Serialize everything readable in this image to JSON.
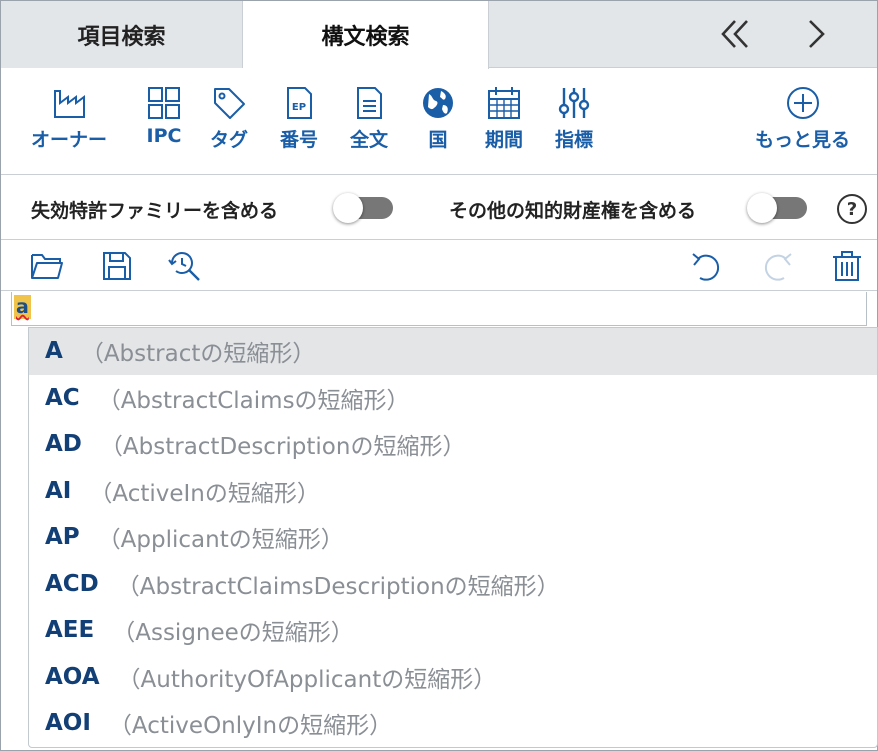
{
  "tabs": {
    "item_search": "項目検索",
    "syntax_search": "構文検索"
  },
  "filters": [
    {
      "label": "オーナー",
      "icon": "factory-icon"
    },
    {
      "label": "IPC",
      "icon": "grid-icon"
    },
    {
      "label": "タグ",
      "icon": "tag-icon"
    },
    {
      "label": "番号",
      "icon": "ep-document-icon"
    },
    {
      "label": "全文",
      "icon": "document-icon"
    },
    {
      "label": "国",
      "icon": "globe-icon"
    },
    {
      "label": "期間",
      "icon": "calendar-icon"
    },
    {
      "label": "指標",
      "icon": "sliders-icon"
    }
  ],
  "more_label": "もっと見る",
  "toggles": {
    "expired_family": "失効特許ファミリーを含める",
    "other_ip": "その他の知的財産権を含める",
    "help": "?"
  },
  "editor": {
    "typed_text": "a"
  },
  "suggestions": [
    {
      "code": "A",
      "desc": "（Abstractの短縮形）"
    },
    {
      "code": "AC",
      "desc": "（AbstractClaimsの短縮形）"
    },
    {
      "code": "AD",
      "desc": "（AbstractDescriptionの短縮形）"
    },
    {
      "code": "AI",
      "desc": "（ActiveInの短縮形）"
    },
    {
      "code": "AP",
      "desc": "（Applicantの短縮形）"
    },
    {
      "code": "ACD",
      "desc": "（AbstractClaimsDescriptionの短縮形）"
    },
    {
      "code": "AEE",
      "desc": "（Assigneeの短縮形）"
    },
    {
      "code": "AOA",
      "desc": "（AuthorityOfApplicantの短縮形）"
    },
    {
      "code": "AOI",
      "desc": "（ActiveOnlyInの短縮形）"
    }
  ],
  "colors": {
    "accent": "#1b5ea8",
    "code_text": "#123f75",
    "desc_text": "#8a8f95",
    "highlight": "#f0c34a"
  }
}
